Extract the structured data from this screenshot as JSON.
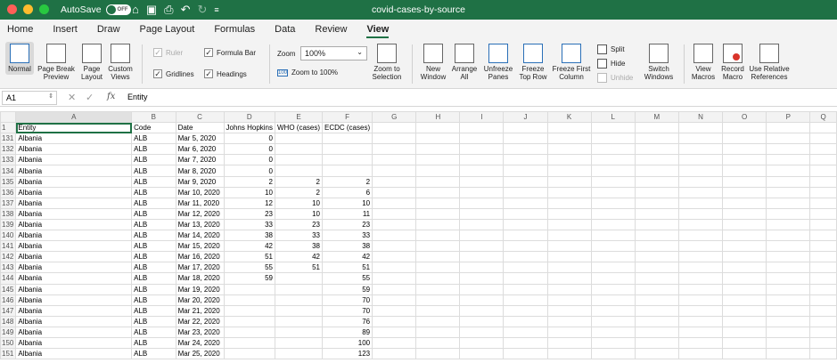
{
  "window": {
    "autosave_label": "AutoSave",
    "autosave_state": "OFF",
    "title": "covid-cases-by-source",
    "colors": {
      "titlebar": "#1f7145"
    }
  },
  "menu": {
    "tabs": [
      "Home",
      "Insert",
      "Draw",
      "Page Layout",
      "Formulas",
      "Data",
      "Review",
      "View"
    ],
    "active": "View"
  },
  "ribbon": {
    "normal": "Normal",
    "page_break_preview": [
      "Page Break",
      "Preview"
    ],
    "page_layout": [
      "Page",
      "Layout"
    ],
    "custom_views": [
      "Custom",
      "Views"
    ],
    "ruler": "Ruler",
    "formula_bar": "Formula Bar",
    "gridlines": "Gridlines",
    "headings": "Headings",
    "zoom_label": "Zoom",
    "zoom_value": "100%",
    "zoom_to_100": "Zoom to 100%",
    "zoom_to_selection": [
      "Zoom to",
      "Selection"
    ],
    "new_window": [
      "New",
      "Window"
    ],
    "arrange_all": [
      "Arrange",
      "All"
    ],
    "unfreeze_panes": [
      "Unfreeze",
      "Panes"
    ],
    "freeze_top_row": [
      "Freeze",
      "Top Row"
    ],
    "freeze_first_column": [
      "Freeze First",
      "Column"
    ],
    "split": "Split",
    "hide": "Hide",
    "unhide": "Unhide",
    "switch_windows": [
      "Switch",
      "Windows"
    ],
    "view_macros": [
      "View",
      "Macros"
    ],
    "record_macro": [
      "Record",
      "Macro"
    ],
    "use_relative_references": [
      "Use Relative",
      "References"
    ]
  },
  "formula_bar": {
    "cell_ref": "A1",
    "content": "Entity"
  },
  "sheet": {
    "columns": [
      "A",
      "B",
      "C",
      "D",
      "E",
      "F",
      "G",
      "H",
      "I",
      "J",
      "K",
      "L",
      "M",
      "N",
      "O",
      "P",
      "Q"
    ],
    "header_row": {
      "num": "1",
      "cells": [
        "Entity",
        "Code",
        "Date",
        "Johns Hopkins",
        "WHO (cases)",
        "ECDC (cases)"
      ]
    },
    "rows": [
      {
        "num": "131",
        "entity": "Albania",
        "code": "ALB",
        "date": "Mar 5, 2020",
        "jh": "0",
        "who": "",
        "ecdc": ""
      },
      {
        "num": "132",
        "entity": "Albania",
        "code": "ALB",
        "date": "Mar 6, 2020",
        "jh": "0",
        "who": "",
        "ecdc": ""
      },
      {
        "num": "133",
        "entity": "Albania",
        "code": "ALB",
        "date": "Mar 7, 2020",
        "jh": "0",
        "who": "",
        "ecdc": ""
      },
      {
        "num": "134",
        "entity": "Albania",
        "code": "ALB",
        "date": "Mar 8, 2020",
        "jh": "0",
        "who": "",
        "ecdc": ""
      },
      {
        "num": "135",
        "entity": "Albania",
        "code": "ALB",
        "date": "Mar 9, 2020",
        "jh": "2",
        "who": "2",
        "ecdc": "2"
      },
      {
        "num": "136",
        "entity": "Albania",
        "code": "ALB",
        "date": "Mar 10, 2020",
        "jh": "10",
        "who": "2",
        "ecdc": "6"
      },
      {
        "num": "137",
        "entity": "Albania",
        "code": "ALB",
        "date": "Mar 11, 2020",
        "jh": "12",
        "who": "10",
        "ecdc": "10"
      },
      {
        "num": "138",
        "entity": "Albania",
        "code": "ALB",
        "date": "Mar 12, 2020",
        "jh": "23",
        "who": "10",
        "ecdc": "11"
      },
      {
        "num": "139",
        "entity": "Albania",
        "code": "ALB",
        "date": "Mar 13, 2020",
        "jh": "33",
        "who": "23",
        "ecdc": "23"
      },
      {
        "num": "140",
        "entity": "Albania",
        "code": "ALB",
        "date": "Mar 14, 2020",
        "jh": "38",
        "who": "33",
        "ecdc": "33"
      },
      {
        "num": "141",
        "entity": "Albania",
        "code": "ALB",
        "date": "Mar 15, 2020",
        "jh": "42",
        "who": "38",
        "ecdc": "38"
      },
      {
        "num": "142",
        "entity": "Albania",
        "code": "ALB",
        "date": "Mar 16, 2020",
        "jh": "51",
        "who": "42",
        "ecdc": "42"
      },
      {
        "num": "143",
        "entity": "Albania",
        "code": "ALB",
        "date": "Mar 17, 2020",
        "jh": "55",
        "who": "51",
        "ecdc": "51"
      },
      {
        "num": "144",
        "entity": "Albania",
        "code": "ALB",
        "date": "Mar 18, 2020",
        "jh": "59",
        "who": "",
        "ecdc": "55"
      },
      {
        "num": "145",
        "entity": "Albania",
        "code": "ALB",
        "date": "Mar 19, 2020",
        "jh": "",
        "who": "",
        "ecdc": "59"
      },
      {
        "num": "146",
        "entity": "Albania",
        "code": "ALB",
        "date": "Mar 20, 2020",
        "jh": "",
        "who": "",
        "ecdc": "70"
      },
      {
        "num": "147",
        "entity": "Albania",
        "code": "ALB",
        "date": "Mar 21, 2020",
        "jh": "",
        "who": "",
        "ecdc": "70"
      },
      {
        "num": "148",
        "entity": "Albania",
        "code": "ALB",
        "date": "Mar 22, 2020",
        "jh": "",
        "who": "",
        "ecdc": "76"
      },
      {
        "num": "149",
        "entity": "Albania",
        "code": "ALB",
        "date": "Mar 23, 2020",
        "jh": "",
        "who": "",
        "ecdc": "89"
      },
      {
        "num": "150",
        "entity": "Albania",
        "code": "ALB",
        "date": "Mar 24, 2020",
        "jh": "",
        "who": "",
        "ecdc": "100"
      },
      {
        "num": "151",
        "entity": "Albania",
        "code": "ALB",
        "date": "Mar 25, 2020",
        "jh": "",
        "who": "",
        "ecdc": "123"
      }
    ]
  }
}
